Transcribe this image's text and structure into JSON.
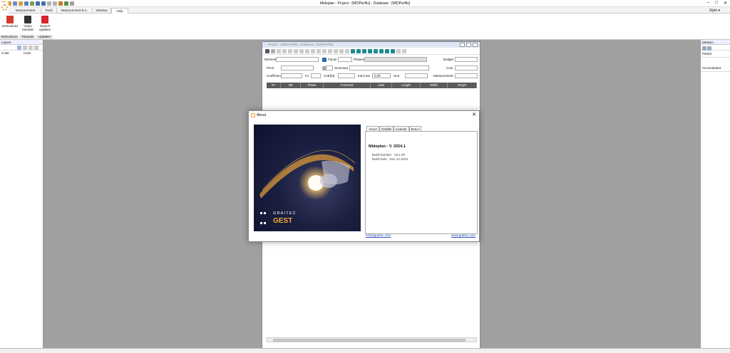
{
  "window": {
    "title": "Mideplan - Project : [MIDPerfils] - Database : [MIDPerfils]"
  },
  "menu_tabs": [
    "Measurement",
    "Tools",
    "Measurement B.C.",
    "Window",
    "Help"
  ],
  "style_menu": "Style ▾",
  "ribbon": {
    "buttons": [
      {
        "label": "Instructions",
        "icon": "pdf-icon"
      },
      {
        "label": "Video tutorials",
        "icon": "video-icon"
      },
      {
        "label": "Search updates",
        "icon": "update-icon"
      }
    ],
    "groups": [
      "Instructions",
      "Tutorials",
      "Updates"
    ]
  },
  "left_panel": {
    "title": "Layers",
    "columns": [
      "Code",
      "Color"
    ]
  },
  "right_panel": {
    "title": "Measur...",
    "rows": [
      "Partial",
      "Accumulated"
    ]
  },
  "project_window": {
    "title": "Project : [MIDPerfils] - Database : [MIDPerfils]",
    "fields": {
      "element": "Element",
      "factor": "Factor",
      "phases": "Phases",
      "budget": "Budget",
      "price": "Price",
      "ud": "Ud",
      "summary": "Summary",
      "cost": "Cost",
      "coeff": "Coefficient",
      "k1": "K1",
      "k2": "CoEf(2)",
      "ind_cost": "Ind.Cost",
      "ind_cost_value": "0,00",
      "unit": "Unit",
      "measurement": "Measurement"
    },
    "grid_columns": [
      "Nº",
      "NB",
      "Phase",
      "Comment",
      "Units",
      "Length",
      "Width",
      "Height"
    ]
  },
  "about": {
    "title": "About",
    "tabs": [
      "About",
      "Credits",
      "License",
      "EULA"
    ],
    "product": "Mideplan - V. 2024.1",
    "build_number": "Build Number : 18.1.00",
    "build_date": "Build Date : Nov 14 2023",
    "email": "info@graitec.com",
    "website": "www.graitec.com",
    "splash_brand": "GRAITEC",
    "splash_product": "GEST"
  },
  "colors": {
    "accent": "#e9a23b",
    "splash_bg": "#1b2040",
    "link": "#2a4fbf"
  }
}
